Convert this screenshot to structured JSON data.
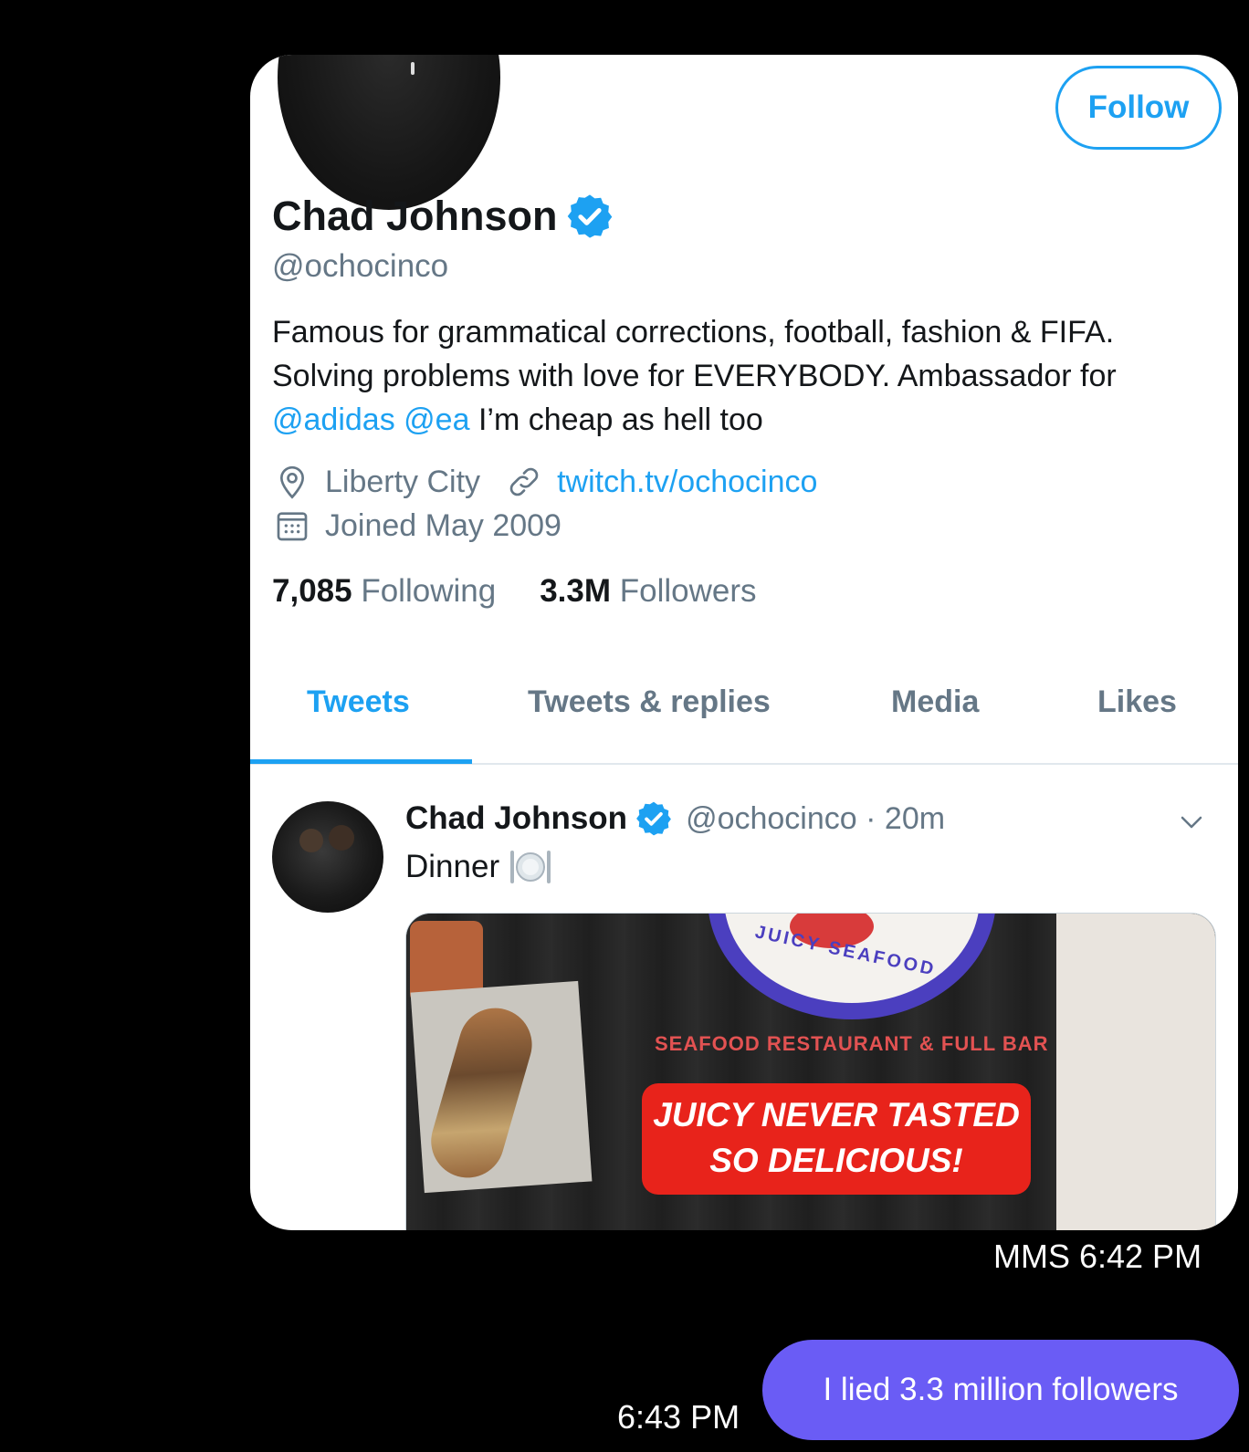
{
  "profile": {
    "follow_label": "Follow",
    "name": "Chad Johnson",
    "handle": "@ochocinco",
    "bio_line1": "Famous for grammatical corrections, football, fashion & FIFA.",
    "bio_line2": "Solving problems with love for EVERYBODY. Ambassador for",
    "bio_mention1": "@adidas",
    "bio_mention2": "@ea",
    "bio_line3_rest": " I’m cheap as hell too",
    "location": "Liberty City",
    "website": "twitch.tv/ochocinco",
    "joined": "Joined May 2009",
    "following_count": "7,085",
    "following_label": "Following",
    "followers_count": "3.3M",
    "followers_label": "Followers"
  },
  "tabs": [
    {
      "label": "Tweets"
    },
    {
      "label": "Tweets & replies"
    },
    {
      "label": "Media"
    },
    {
      "label": "Likes"
    }
  ],
  "tweet": {
    "name": "Chad Johnson",
    "handle": "@ochocinco",
    "separator": " · ",
    "time": "20m",
    "text": "Dinner",
    "media": {
      "seal_text": "JUICY SEAFOOD",
      "restaurant_text": "SEAFOOD RESTAURANT & FULL BAR",
      "slogan_line1": "JUICY NEVER TASTED",
      "slogan_line2": "SO DELICIOUS!"
    }
  },
  "messages": {
    "mms_time": "MMS 6:42 PM",
    "sent_text": "I lied 3.3 million followers",
    "sent_time": "6:43 PM"
  },
  "colors": {
    "twitter_blue": "#1da1f2",
    "bubble": "#6a5cf5",
    "background": "#000000"
  },
  "icons": [
    "verified-badge-icon",
    "location-pin-icon",
    "link-icon",
    "calendar-icon",
    "chevron-down-icon",
    "plate-cutlery-icon"
  ]
}
